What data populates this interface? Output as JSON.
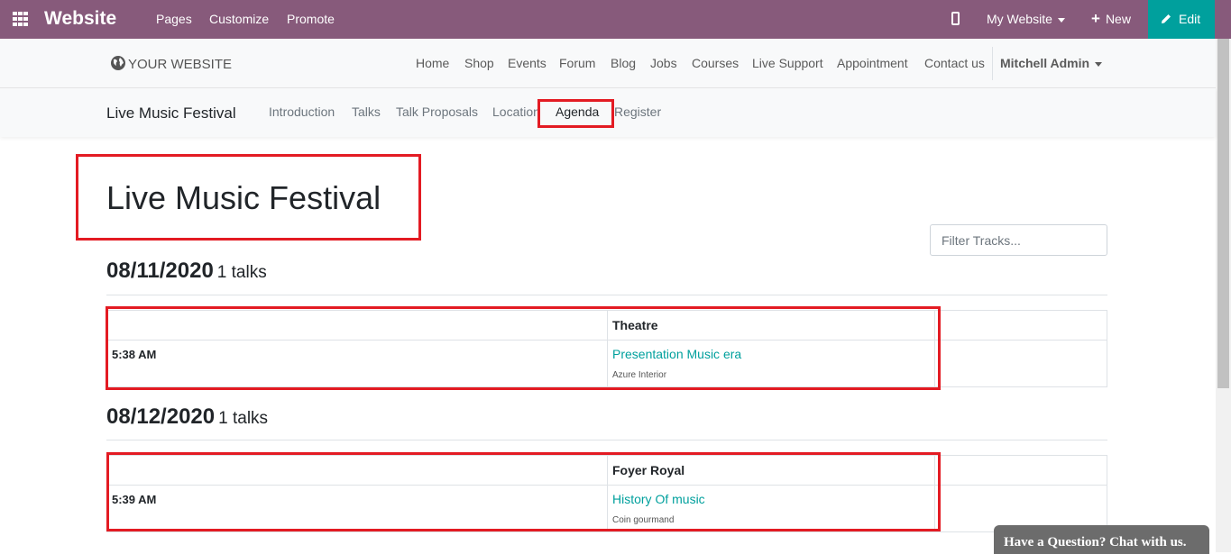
{
  "topbar": {
    "app_title": "Website",
    "menu": [
      "Pages",
      "Customize",
      "Promote"
    ],
    "my_website": "My Website",
    "new_label": "New",
    "edit_label": "Edit"
  },
  "site_nav": {
    "logo_text": "YOUR WEBSITE",
    "links": [
      "Home",
      "Shop",
      "Events",
      "Forum",
      "Blog",
      "Jobs",
      "Courses",
      "Live Support",
      "Appointment",
      "Contact us"
    ],
    "user": "Mitchell Admin"
  },
  "event_nav": {
    "event_name": "Live Music Festival",
    "links": [
      "Introduction",
      "Talks",
      "Talk Proposals",
      "Location",
      "Agenda",
      "Register"
    ],
    "active": "Agenda"
  },
  "content": {
    "title": "Live Music Festival",
    "filter_placeholder": "Filter Tracks...",
    "days": [
      {
        "date": "08/11/2020",
        "count": "1 talks",
        "track": "Theatre",
        "time": "5:38 AM",
        "talk": "Presentation Music era",
        "speaker": "Azure Interior"
      },
      {
        "date": "08/12/2020",
        "count": "1 talks",
        "track": "Foyer Royal",
        "time": "5:39 AM",
        "talk": "History Of music",
        "speaker": "Coin gourmand"
      }
    ]
  },
  "chat": {
    "label": "Have a Question? Chat with us."
  },
  "colors": {
    "topbar": "#875a7b",
    "edit": "#00a09d",
    "link": "#00a09d",
    "highlight": "#e31b23"
  }
}
